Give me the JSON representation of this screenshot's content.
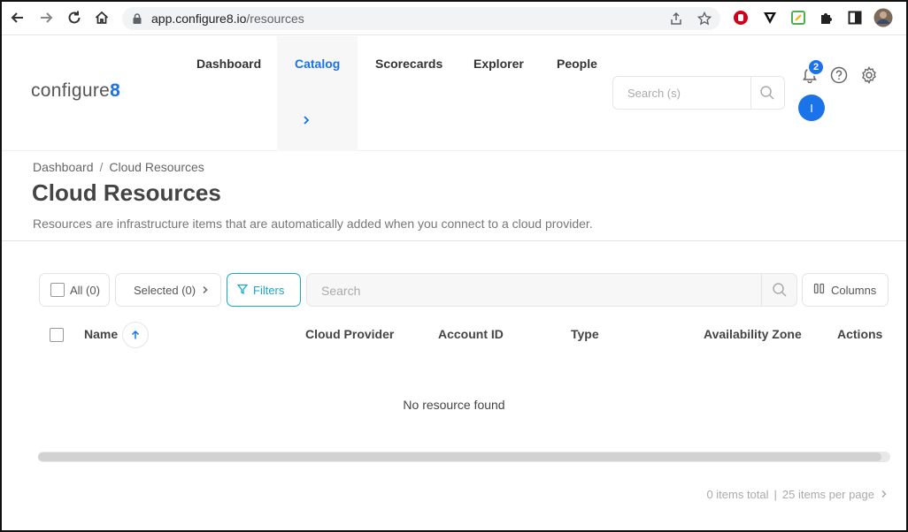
{
  "browser": {
    "url_host": "app.configure8.io",
    "url_path": "/resources"
  },
  "logo": {
    "text": "configure",
    "digit": "8"
  },
  "nav": {
    "items": [
      {
        "label": "Dashboard"
      },
      {
        "label": "Catalog",
        "active": true
      },
      {
        "label": "Scorecards"
      },
      {
        "label": "Explorer"
      },
      {
        "label": "People"
      }
    ]
  },
  "header": {
    "search_placeholder": "Search (s)",
    "notifications_count": "2",
    "avatar_initial": "I"
  },
  "breadcrumb": {
    "root": "Dashboard",
    "separator": "/",
    "current": "Cloud Resources"
  },
  "page": {
    "title": "Cloud Resources",
    "description": "Resources are infrastructure items that are automatically added when you connect to a cloud provider."
  },
  "toolbar": {
    "all_label": "All (0)",
    "selected_label": "Selected (0)",
    "filters_label": "Filters",
    "search_placeholder": "Search",
    "columns_label": "Columns"
  },
  "table": {
    "columns": [
      "Name",
      "Cloud Provider",
      "Account ID",
      "Type",
      "Availability Zone",
      "Actions"
    ],
    "empty_text": "No resource found"
  },
  "pagination": {
    "total_label": "0 items total",
    "per_page_label": "25 items per page"
  },
  "colors": {
    "accent": "#1a73e8",
    "filter_accent": "#1aa6c4"
  }
}
